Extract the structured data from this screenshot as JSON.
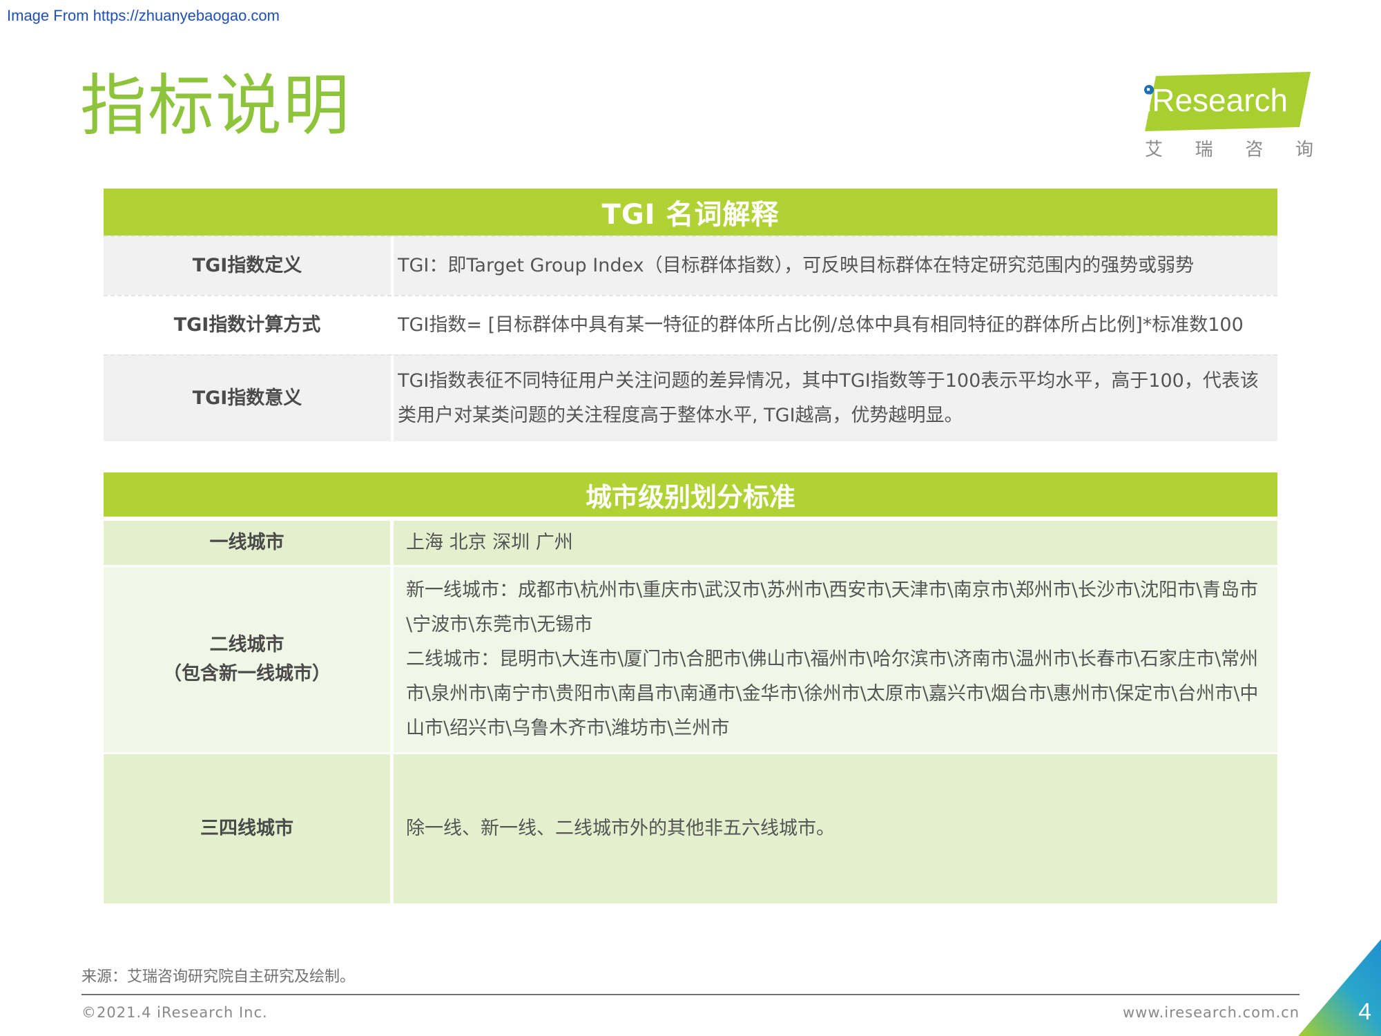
{
  "source_link": "Image From https://zhuanyebaogao.com",
  "page_title": "指标说明",
  "logo": {
    "wordmark": "iResearch",
    "chinese": [
      "艾",
      "瑞",
      "咨",
      "询"
    ]
  },
  "tgi_table": {
    "header": "TGI  名词解释",
    "rows": [
      {
        "label": "TGI指数定义",
        "value": "TGI：即Target Group Index（目标群体指数），可反映目标群体在特定研究范围内的强势或弱势"
      },
      {
        "label": "TGI指数计算方式",
        "value": "TGI指数= [目标群体中具有某一特征的群体所占比例/总体中具有相同特征的群体所占比例]*标准数100"
      },
      {
        "label": "TGI指数意义",
        "value": "TGI指数表征不同特征用户关注问题的差异情况，其中TGI指数等于100表示平均水平，高于100，代表该类用户对某类问题的关注程度高于整体水平, TGI越高，优势越明显。"
      }
    ]
  },
  "city_table": {
    "header": "城市级别划分标准",
    "rows": [
      {
        "label": "一线城市",
        "value": "上海 北京 深圳 广州"
      },
      {
        "label_line1": "二线城市",
        "label_line2": "（包含新一线城市）",
        "value_new_tier1": "新一线城市：成都市\\杭州市\\重庆市\\武汉市\\苏州市\\西安市\\天津市\\南京市\\郑州市\\长沙市\\沈阳市\\青岛市\\宁波市\\东莞市\\无锡市",
        "value_tier2": "二线城市：昆明市\\大连市\\厦门市\\合肥市\\佛山市\\福州市\\哈尔滨市\\济南市\\温州市\\长春市\\石家庄市\\常州市\\泉州市\\南宁市\\贵阳市\\南昌市\\南通市\\金华市\\徐州市\\太原市\\嘉兴市\\烟台市\\惠州市\\保定市\\台州市\\中山市\\绍兴市\\乌鲁木齐市\\潍坊市\\兰州市"
      },
      {
        "label": "三四线城市",
        "value": "除一线、新一线、二线城市外的其他非五六线城市。"
      }
    ]
  },
  "footnote": "来源：艾瑞咨询研究院自主研究及绘制。",
  "footer": {
    "copyright": "©2021.4 iResearch Inc.",
    "website": "www.iresearch.com.cn",
    "page_number": "4"
  },
  "colors": {
    "accent_green": "#8dc43c",
    "header_green": "#b0d235",
    "row_gray": "#f1f1f1",
    "row_green_dark": "#e3efcd",
    "row_green_light": "#f1f7e6"
  }
}
